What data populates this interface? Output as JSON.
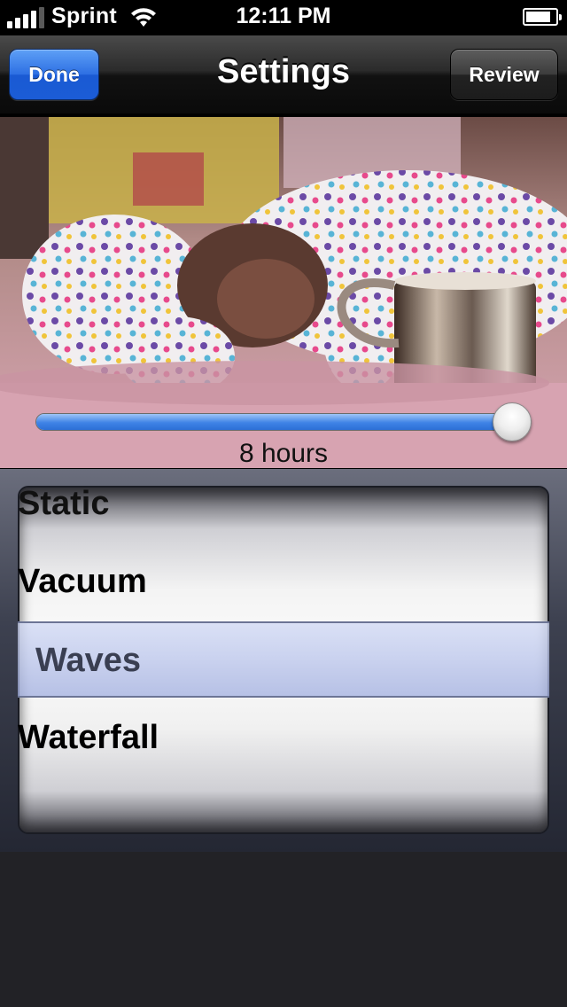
{
  "status_bar": {
    "carrier": "Sprint",
    "time": "12:11 PM",
    "battery_level": 0.85
  },
  "nav": {
    "title": "Settings",
    "left_button": "Done",
    "right_button": "Review"
  },
  "photo": {
    "description_icon": "sleeping-baby-photo"
  },
  "slider": {
    "value_label": "8 hours",
    "fraction": 0.96
  },
  "picker": {
    "items": [
      "Static",
      "Vacuum",
      "Waves",
      "Waterfall"
    ],
    "selected": "Waves"
  },
  "colors": {
    "done_button": "#2d6fe3",
    "slider_fill": "#3f83e6",
    "selection_band": "#a5b2e1"
  }
}
